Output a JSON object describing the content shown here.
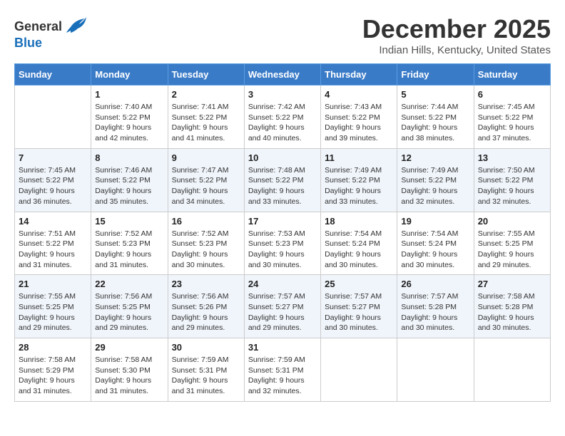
{
  "logo": {
    "line1": "General",
    "line2": "Blue"
  },
  "title": "December 2025",
  "location": "Indian Hills, Kentucky, United States",
  "days_header": [
    "Sunday",
    "Monday",
    "Tuesday",
    "Wednesday",
    "Thursday",
    "Friday",
    "Saturday"
  ],
  "weeks": [
    [
      {
        "num": "",
        "sunrise": "",
        "sunset": "",
        "daylight": ""
      },
      {
        "num": "1",
        "sunrise": "Sunrise: 7:40 AM",
        "sunset": "Sunset: 5:22 PM",
        "daylight": "Daylight: 9 hours and 42 minutes."
      },
      {
        "num": "2",
        "sunrise": "Sunrise: 7:41 AM",
        "sunset": "Sunset: 5:22 PM",
        "daylight": "Daylight: 9 hours and 41 minutes."
      },
      {
        "num": "3",
        "sunrise": "Sunrise: 7:42 AM",
        "sunset": "Sunset: 5:22 PM",
        "daylight": "Daylight: 9 hours and 40 minutes."
      },
      {
        "num": "4",
        "sunrise": "Sunrise: 7:43 AM",
        "sunset": "Sunset: 5:22 PM",
        "daylight": "Daylight: 9 hours and 39 minutes."
      },
      {
        "num": "5",
        "sunrise": "Sunrise: 7:44 AM",
        "sunset": "Sunset: 5:22 PM",
        "daylight": "Daylight: 9 hours and 38 minutes."
      },
      {
        "num": "6",
        "sunrise": "Sunrise: 7:45 AM",
        "sunset": "Sunset: 5:22 PM",
        "daylight": "Daylight: 9 hours and 37 minutes."
      }
    ],
    [
      {
        "num": "7",
        "sunrise": "Sunrise: 7:45 AM",
        "sunset": "Sunset: 5:22 PM",
        "daylight": "Daylight: 9 hours and 36 minutes."
      },
      {
        "num": "8",
        "sunrise": "Sunrise: 7:46 AM",
        "sunset": "Sunset: 5:22 PM",
        "daylight": "Daylight: 9 hours and 35 minutes."
      },
      {
        "num": "9",
        "sunrise": "Sunrise: 7:47 AM",
        "sunset": "Sunset: 5:22 PM",
        "daylight": "Daylight: 9 hours and 34 minutes."
      },
      {
        "num": "10",
        "sunrise": "Sunrise: 7:48 AM",
        "sunset": "Sunset: 5:22 PM",
        "daylight": "Daylight: 9 hours and 33 minutes."
      },
      {
        "num": "11",
        "sunrise": "Sunrise: 7:49 AM",
        "sunset": "Sunset: 5:22 PM",
        "daylight": "Daylight: 9 hours and 33 minutes."
      },
      {
        "num": "12",
        "sunrise": "Sunrise: 7:49 AM",
        "sunset": "Sunset: 5:22 PM",
        "daylight": "Daylight: 9 hours and 32 minutes."
      },
      {
        "num": "13",
        "sunrise": "Sunrise: 7:50 AM",
        "sunset": "Sunset: 5:22 PM",
        "daylight": "Daylight: 9 hours and 32 minutes."
      }
    ],
    [
      {
        "num": "14",
        "sunrise": "Sunrise: 7:51 AM",
        "sunset": "Sunset: 5:22 PM",
        "daylight": "Daylight: 9 hours and 31 minutes."
      },
      {
        "num": "15",
        "sunrise": "Sunrise: 7:52 AM",
        "sunset": "Sunset: 5:23 PM",
        "daylight": "Daylight: 9 hours and 31 minutes."
      },
      {
        "num": "16",
        "sunrise": "Sunrise: 7:52 AM",
        "sunset": "Sunset: 5:23 PM",
        "daylight": "Daylight: 9 hours and 30 minutes."
      },
      {
        "num": "17",
        "sunrise": "Sunrise: 7:53 AM",
        "sunset": "Sunset: 5:23 PM",
        "daylight": "Daylight: 9 hours and 30 minutes."
      },
      {
        "num": "18",
        "sunrise": "Sunrise: 7:54 AM",
        "sunset": "Sunset: 5:24 PM",
        "daylight": "Daylight: 9 hours and 30 minutes."
      },
      {
        "num": "19",
        "sunrise": "Sunrise: 7:54 AM",
        "sunset": "Sunset: 5:24 PM",
        "daylight": "Daylight: 9 hours and 30 minutes."
      },
      {
        "num": "20",
        "sunrise": "Sunrise: 7:55 AM",
        "sunset": "Sunset: 5:25 PM",
        "daylight": "Daylight: 9 hours and 29 minutes."
      }
    ],
    [
      {
        "num": "21",
        "sunrise": "Sunrise: 7:55 AM",
        "sunset": "Sunset: 5:25 PM",
        "daylight": "Daylight: 9 hours and 29 minutes."
      },
      {
        "num": "22",
        "sunrise": "Sunrise: 7:56 AM",
        "sunset": "Sunset: 5:25 PM",
        "daylight": "Daylight: 9 hours and 29 minutes."
      },
      {
        "num": "23",
        "sunrise": "Sunrise: 7:56 AM",
        "sunset": "Sunset: 5:26 PM",
        "daylight": "Daylight: 9 hours and 29 minutes."
      },
      {
        "num": "24",
        "sunrise": "Sunrise: 7:57 AM",
        "sunset": "Sunset: 5:27 PM",
        "daylight": "Daylight: 9 hours and 29 minutes."
      },
      {
        "num": "25",
        "sunrise": "Sunrise: 7:57 AM",
        "sunset": "Sunset: 5:27 PM",
        "daylight": "Daylight: 9 hours and 30 minutes."
      },
      {
        "num": "26",
        "sunrise": "Sunrise: 7:57 AM",
        "sunset": "Sunset: 5:28 PM",
        "daylight": "Daylight: 9 hours and 30 minutes."
      },
      {
        "num": "27",
        "sunrise": "Sunrise: 7:58 AM",
        "sunset": "Sunset: 5:28 PM",
        "daylight": "Daylight: 9 hours and 30 minutes."
      }
    ],
    [
      {
        "num": "28",
        "sunrise": "Sunrise: 7:58 AM",
        "sunset": "Sunset: 5:29 PM",
        "daylight": "Daylight: 9 hours and 31 minutes."
      },
      {
        "num": "29",
        "sunrise": "Sunrise: 7:58 AM",
        "sunset": "Sunset: 5:30 PM",
        "daylight": "Daylight: 9 hours and 31 minutes."
      },
      {
        "num": "30",
        "sunrise": "Sunrise: 7:59 AM",
        "sunset": "Sunset: 5:31 PM",
        "daylight": "Daylight: 9 hours and 31 minutes."
      },
      {
        "num": "31",
        "sunrise": "Sunrise: 7:59 AM",
        "sunset": "Sunset: 5:31 PM",
        "daylight": "Daylight: 9 hours and 32 minutes."
      },
      {
        "num": "",
        "sunrise": "",
        "sunset": "",
        "daylight": ""
      },
      {
        "num": "",
        "sunrise": "",
        "sunset": "",
        "daylight": ""
      },
      {
        "num": "",
        "sunrise": "",
        "sunset": "",
        "daylight": ""
      }
    ]
  ]
}
